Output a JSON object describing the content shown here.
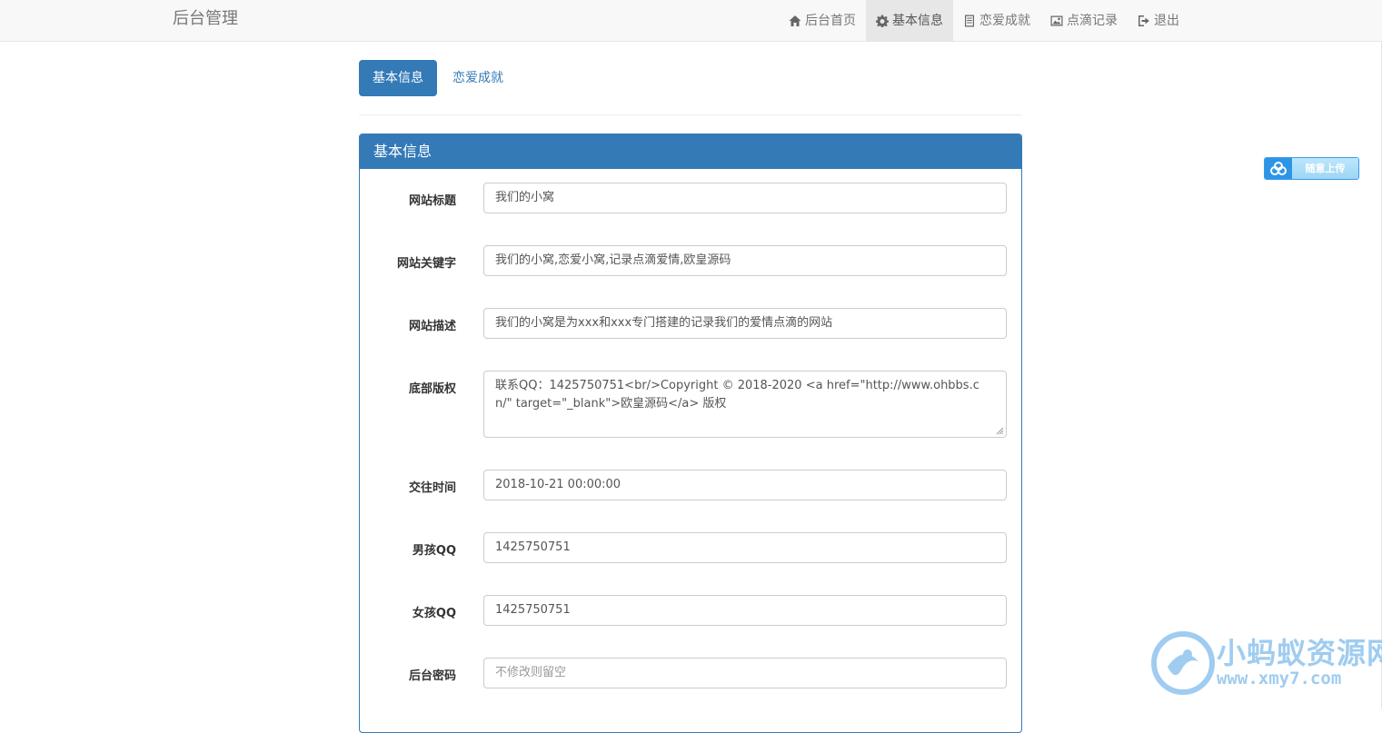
{
  "navbar": {
    "brand": "后台管理",
    "items": [
      {
        "label": "后台首页",
        "icon": "home-icon",
        "active": false
      },
      {
        "label": "基本信息",
        "icon": "gear-icon",
        "active": true
      },
      {
        "label": "恋爱成就",
        "icon": "list-icon",
        "active": false
      },
      {
        "label": "点滴记录",
        "icon": "image-icon",
        "active": false
      },
      {
        "label": "退出",
        "icon": "logout-icon",
        "active": false
      }
    ]
  },
  "tabs": [
    {
      "label": "基本信息",
      "active": true
    },
    {
      "label": "恋爱成就",
      "active": false
    }
  ],
  "panel": {
    "title": "基本信息",
    "fields": {
      "site_title": {
        "label": "网站标题",
        "value": "我们的小窝"
      },
      "site_keywords": {
        "label": "网站关键字",
        "value": "我们的小窝,恋爱小窝,记录点滴爱情,欧皇源码"
      },
      "site_description": {
        "label": "网站描述",
        "value": "我们的小窝是为xxx和xxx专门搭建的记录我们的爱情点滴的网站"
      },
      "footer_copyright": {
        "label": "底部版权",
        "value": "联系QQ：1425750751<br/>Copyright © 2018-2020 <a href=\"http://www.ohbbs.cn/\" target=\"_blank\">欧皇源码</a> 版权"
      },
      "dating_time": {
        "label": "交往时间",
        "value": "2018-10-21 00:00:00"
      },
      "boy_qq": {
        "label": "男孩QQ",
        "value": "1425750751"
      },
      "girl_qq": {
        "label": "女孩QQ",
        "value": "1425750751"
      },
      "admin_password": {
        "label": "后台密码",
        "value": "",
        "placeholder": "不修改则留空"
      }
    }
  },
  "upload_widget": {
    "label": "随意上传",
    "icon": "cloud-upload-icon"
  },
  "watermark": {
    "title": "小蚂蚁资源网",
    "url": "www.xmy7.com"
  },
  "colors": {
    "primary": "#337ab7",
    "navbar_bg": "#f8f8f8",
    "active_nav_bg": "#e7e7e7"
  }
}
